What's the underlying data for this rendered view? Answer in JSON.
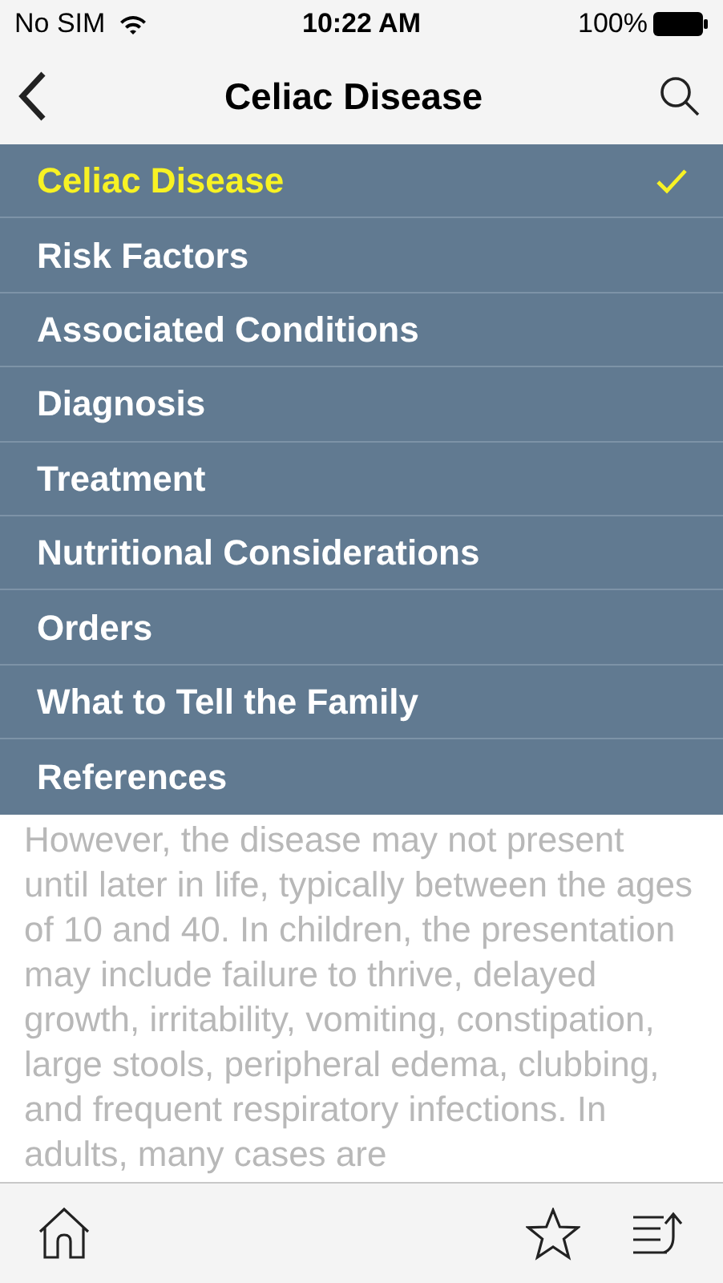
{
  "status_bar": {
    "carrier": "No SIM",
    "time": "10:22 AM",
    "battery": "100%"
  },
  "nav": {
    "title": "Celiac Disease"
  },
  "menu": [
    {
      "label": "Celiac Disease",
      "selected": true
    },
    {
      "label": "Risk Factors",
      "selected": false
    },
    {
      "label": "Associated Conditions",
      "selected": false
    },
    {
      "label": "Diagnosis",
      "selected": false
    },
    {
      "label": "Treatment",
      "selected": false
    },
    {
      "label": "Nutritional Considerations",
      "selected": false
    },
    {
      "label": "Orders",
      "selected": false
    },
    {
      "label": "What to Tell the Family",
      "selected": false
    },
    {
      "label": "References",
      "selected": false
    }
  ],
  "body_text": "However, the disease may not present until later in life, typically between the ages of 10 and 40. In children, the presentation may include failure to thrive, delayed growth, irritability, vomiting, constipation, large stools, peripheral edema, clubbing, and frequent respiratory infections. In adults, many cases are"
}
